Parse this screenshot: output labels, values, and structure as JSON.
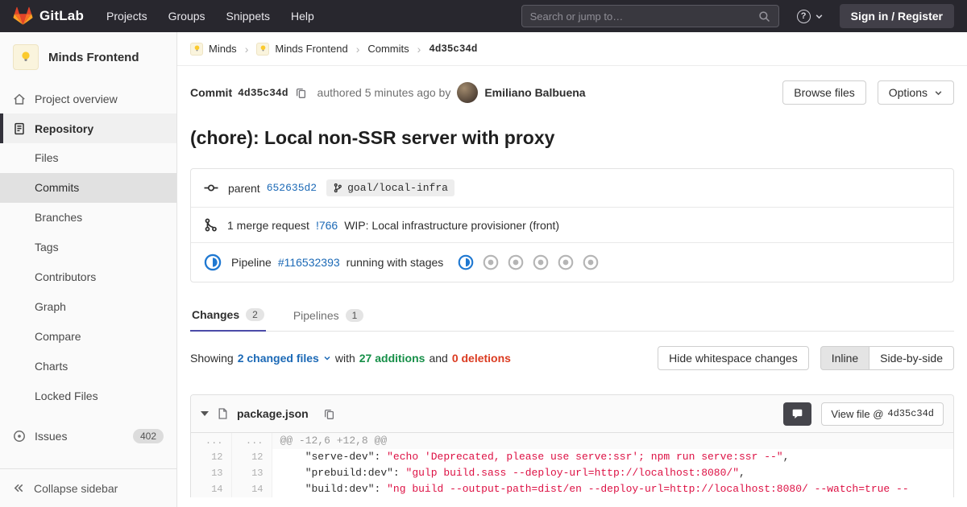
{
  "colors": {
    "navbar_bg": "#28272e",
    "accent_indigo": "#4b4ba8",
    "link_blue": "#1b69b6",
    "additions_green": "#168f48",
    "deletions_red": "#db3b21",
    "code_string_red": "#dd1144",
    "pipeline_running_blue": "#1f78d1"
  },
  "icons": {
    "gitlab-logo-icon": "tanuki",
    "search-icon": "magnifier",
    "help-icon": "question-mark-circle",
    "chevron-down-icon": "chevron-down",
    "project-avatar-icon": "lightbulb",
    "home-icon": "house",
    "repository-icon": "document-lines",
    "issues-icon": "circle-dot",
    "collapse-icon": "double-chevron-left",
    "copy-icon": "duplicate",
    "commit-icon": "commit-node",
    "branch-icon": "git-branch",
    "merge-request-icon": "git-merge",
    "pipeline-running-icon": "blue-half-circle",
    "pipeline-created-icon": "gray-dot-circle",
    "comment-icon": "speech-bubble",
    "file-icon": "document",
    "collapse-file-icon": "triangle-down"
  },
  "navbar": {
    "brand": "GitLab",
    "menu": [
      "Projects",
      "Groups",
      "Snippets",
      "Help"
    ],
    "search_placeholder": "Search or jump to…",
    "help_glyph": "?",
    "sign_in_label": "Sign in / Register"
  },
  "sidebar": {
    "project_name": "Minds Frontend",
    "overview_label": "Project overview",
    "repository_label": "Repository",
    "repo_items": [
      "Files",
      "Commits",
      "Branches",
      "Tags",
      "Contributors",
      "Graph",
      "Compare",
      "Charts",
      "Locked Files"
    ],
    "issues_label": "Issues",
    "issues_count": "402",
    "collapse_label": "Collapse sidebar"
  },
  "breadcrumb": {
    "separator": "›",
    "group": "Minds",
    "project": "Minds Frontend",
    "section": "Commits",
    "current": "4d35c34d"
  },
  "commit": {
    "label": "Commit",
    "sha": "4d35c34d",
    "authored_text": "authored 5 minutes ago by",
    "author": "Emiliano Balbuena",
    "browse_files_label": "Browse files",
    "options_label": "Options",
    "title": "(chore): Local non-SSR server with proxy",
    "parent_label": "parent",
    "parent_sha": "652635d2",
    "branch": "goal/local-infra",
    "mr_count_text": "1 merge request",
    "mr_ref": "!766",
    "mr_title": "WIP: Local infrastructure provisioner (front)",
    "pipeline_label": "Pipeline",
    "pipeline_id": "#116532393",
    "pipeline_status_text": "running with stages"
  },
  "tabs": {
    "changes_label": "Changes",
    "changes_count": "2",
    "pipelines_label": "Pipelines",
    "pipelines_count": "1"
  },
  "controls": {
    "showing": "Showing",
    "changed_files": "2 changed files",
    "with_text": "with",
    "additions": "27 additions",
    "and_text": "and",
    "deletions": "0 deletions",
    "hide_whitespace_label": "Hide whitespace changes",
    "inline_label": "Inline",
    "side_by_side_label": "Side-by-side"
  },
  "diff": {
    "file_name": "package.json",
    "view_file_label": "View file @",
    "view_file_sha": "4d35c34d",
    "rows": [
      {
        "old": "...",
        "new": "...",
        "pre": "@@ -12,6 +12,8 @@",
        "str": "",
        "post": ""
      },
      {
        "old": "12",
        "new": "12",
        "pre": "    \"serve-dev\": ",
        "str": "\"echo 'Deprecated, please use serve:ssr'; npm run serve:ssr --\"",
        "post": ","
      },
      {
        "old": "13",
        "new": "13",
        "pre": "    \"prebuild:dev\": ",
        "str": "\"gulp build.sass --deploy-url=http://localhost:8080/\"",
        "post": ","
      },
      {
        "old": "14",
        "new": "14",
        "pre": "    \"build:dev\": ",
        "str": "\"ng build --output-path=dist/en --deploy-url=http://localhost:8080/ --watch=true --",
        "post": ""
      }
    ]
  }
}
